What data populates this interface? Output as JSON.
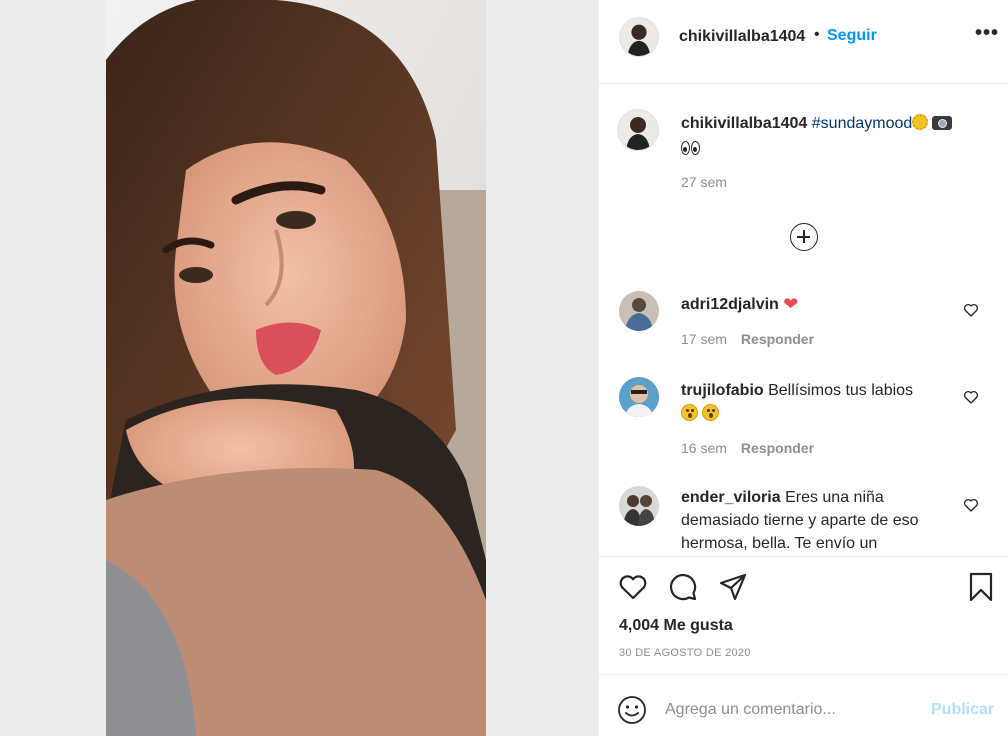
{
  "post": {
    "username": "chikivillalba1404",
    "separator": "•",
    "follow_label": "Seguir",
    "more_label": "•••",
    "caption": {
      "username": "chikivillalba1404",
      "hashtag": "#sundaymood",
      "time": "27 sem"
    },
    "comments": [
      {
        "username": "adri12djalvin",
        "text": "",
        "time": "17 sem",
        "reply": "Responder"
      },
      {
        "username": "trujilofabio",
        "text": "Bellísimos tus labios",
        "time": "16 sem",
        "reply": "Responder"
      },
      {
        "username": "ender_viloria",
        "text": "Eres una niña demasiado tierne y aparte de eso hermosa, bella. Te envío un"
      }
    ],
    "likes": "4,004 Me gusta",
    "date": "30 DE AGOSTO DE 2020",
    "add_comment": {
      "placeholder": "Agrega un comentario...",
      "publish_label": "Publicar"
    },
    "icons": {
      "like": "heart-icon",
      "comment": "comment-icon",
      "share": "send-icon",
      "save": "bookmark-icon",
      "emoji": "smile-icon",
      "load_more": "plus-circle-icon"
    },
    "colors": {
      "link": "#0095f6",
      "hashtag": "#00376b",
      "muted": "#8e8e8e",
      "publish_disabled": "#b2dffc",
      "heart": "#ed4956"
    }
  }
}
